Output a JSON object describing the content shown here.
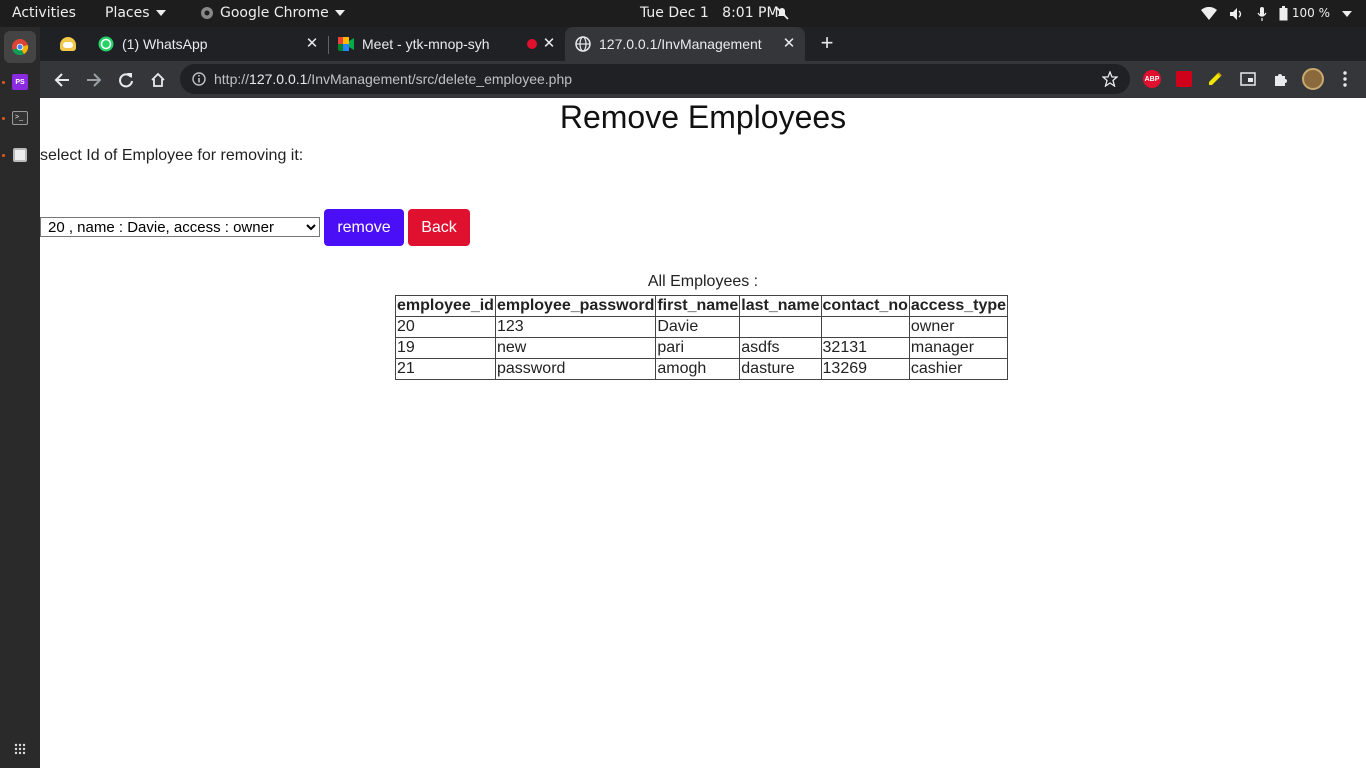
{
  "topbar": {
    "activities": "Activities",
    "places": "Places",
    "app": "Google Chrome",
    "clock": "Tue Dec 1   8:01 PM",
    "battery": "100 %"
  },
  "tabs": [
    {
      "title": "",
      "icon": "pinned-app-icon"
    },
    {
      "title": "(1) WhatsApp",
      "icon": "whatsapp-icon"
    },
    {
      "title": "Meet - ytk-mnop-syh",
      "icon": "meet-icon"
    },
    {
      "title": "127.0.0.1/InvManagement",
      "icon": "globe-icon"
    }
  ],
  "toolbar": {
    "url_scheme": "http://",
    "url_host": "127.0.0.1",
    "url_path": "/InvManagement/src/delete_employee.php"
  },
  "page": {
    "title": "Remove Employees",
    "instruction": "select Id of Employee for removing it:",
    "selected_option": "20 , name : Davie, access : owner",
    "remove_label": "remove",
    "back_label": "Back",
    "table_caption": "All Employees :",
    "columns": [
      "employee_id",
      "employee_password",
      "first_name",
      "last_name",
      "contact_no",
      "access_type"
    ],
    "rows": [
      [
        "20",
        "123",
        "Davie",
        "",
        "",
        "owner"
      ],
      [
        "19",
        "new",
        "pari",
        "asdfs",
        "32131",
        "manager"
      ],
      [
        "21",
        "password",
        "amogh",
        "dasture",
        "13269",
        "cashier"
      ]
    ]
  },
  "colors": {
    "remove_button": "#4b0ff7",
    "back_button": "#e0102f",
    "topbar": "#1d1d1d",
    "tabstrip": "#202124",
    "toolbar": "#35363a"
  }
}
